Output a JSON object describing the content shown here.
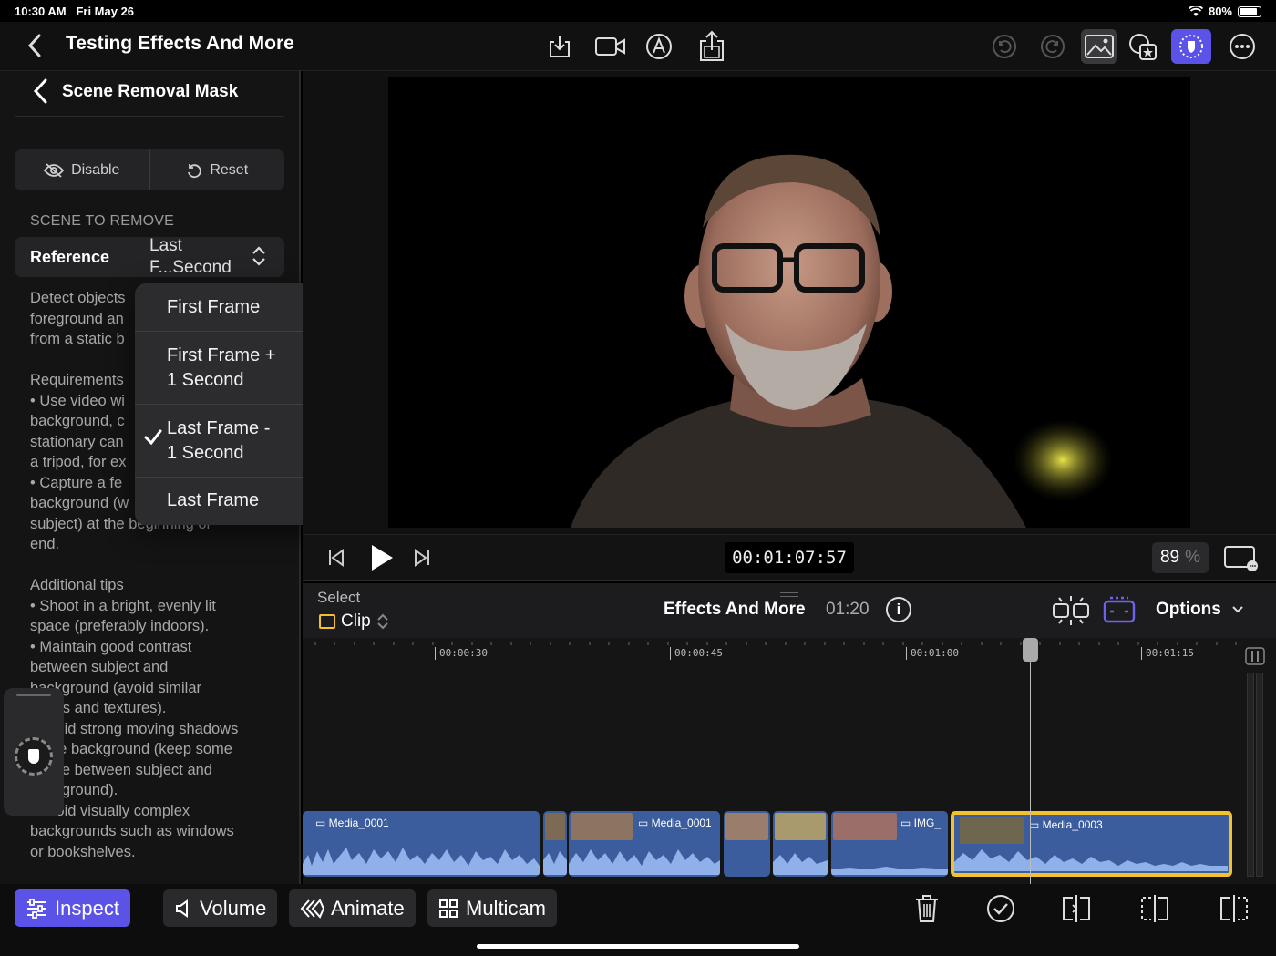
{
  "status": {
    "time": "10:30 AM",
    "date": "Fri May 26",
    "battery": "80%"
  },
  "header": {
    "title": "Testing Effects And More"
  },
  "inspector": {
    "title": "Scene Removal Mask",
    "disable_label": "Disable",
    "reset_label": "Reset",
    "section_title": "SCENE TO REMOVE",
    "reference_label": "Reference",
    "reference_value_line1": "Last",
    "reference_value_line2": "F...Second",
    "desc_1": "Detect objects\nforeground an\nfrom a static b",
    "desc_2": "Requirements\n• Use video wi\nbackground, c\nstationary can\na tripod, for ex\n• Capture a fe\nbackground (w\nsubject) at the beginning or\nend.",
    "desc_3": "Additional tips\n• Shoot in a bright, evenly lit\nspace (preferably indoors).\n• Maintain good contrast\nbetween subject and\nbackground (avoid similar\ncolors and textures).\n• Avoid strong moving shadows\nin the background (keep some\nspace between subject and\nbackground).\n• Avoid visually complex\nbackgrounds such as windows\nor bookshelves."
  },
  "menu": {
    "items": [
      {
        "line1": "First Frame",
        "line2": ""
      },
      {
        "line1": "First Frame +",
        "line2": "1 Second"
      },
      {
        "line1": "Last Frame -",
        "line2": "1 Second"
      },
      {
        "line1": "Last Frame",
        "line2": ""
      }
    ],
    "selected_index": 2
  },
  "transport": {
    "timecode": "00:01:07:57",
    "zoom": "89",
    "zoom_unit": "%"
  },
  "timeline": {
    "select_label": "Select",
    "clip_label": "Clip",
    "project_name": "Effects And More",
    "duration": "01:20",
    "options_label": "Options",
    "ruler": [
      "00:00:30",
      "00:00:45",
      "00:01:00",
      "00:01:15"
    ],
    "clips": [
      {
        "name": "Media_0001"
      },
      {
        "name": ""
      },
      {
        "name": "Media_0001"
      },
      {
        "name": ""
      },
      {
        "name": ""
      },
      {
        "name": "IMG_"
      },
      {
        "name": "Media_0003"
      }
    ]
  },
  "toolbar": {
    "inspect": "Inspect",
    "volume": "Volume",
    "animate": "Animate",
    "multicam": "Multicam"
  },
  "colors": {
    "accent": "#5b52e8",
    "selection": "#f2c12e",
    "clip": "#3b5d9d"
  }
}
